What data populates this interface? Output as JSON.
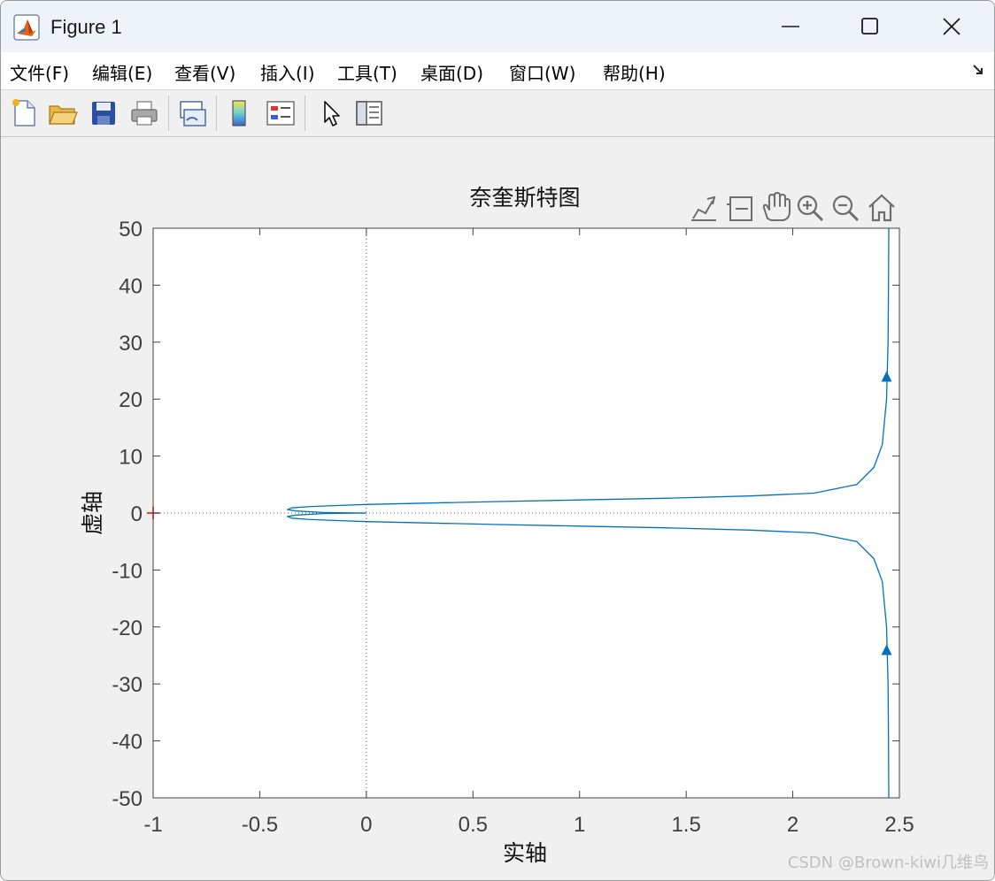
{
  "window": {
    "title": "Figure 1"
  },
  "menu": {
    "items": [
      "文件(F)",
      "编辑(E)",
      "查看(V)",
      "插入(I)",
      "工具(T)",
      "桌面(D)",
      "窗口(W)",
      "帮助(H)"
    ]
  },
  "toolbar": {
    "buttons": [
      "new-figure-icon",
      "open-file-icon",
      "save-icon",
      "print-icon",
      "link-plot-icon",
      "colorbar-icon",
      "legend-icon",
      "edit-plot-cursor-icon",
      "property-inspector-icon"
    ]
  },
  "axes_toolbar": {
    "buttons": [
      "data-tip-icon",
      "brush-icon",
      "pan-hand-icon",
      "zoom-in-icon",
      "zoom-out-icon",
      "home-icon"
    ]
  },
  "colors": {
    "line": "#0072bd",
    "critical_point": "#ff0000",
    "axes": "#404040"
  },
  "chart_data": {
    "type": "line",
    "title": "奈奎斯特图",
    "xlabel": "实轴",
    "ylabel": "虚轴",
    "xlim": [
      -1,
      2.5
    ],
    "ylim": [
      -50,
      50
    ],
    "xticks": [
      "-1",
      "-0.5",
      "0",
      "0.5",
      "1",
      "1.5",
      "2",
      "2.5"
    ],
    "yticks": [
      "-50",
      "-40",
      "-30",
      "-20",
      "-10",
      "0",
      "10",
      "20",
      "30",
      "40",
      "50"
    ],
    "critical_point": [
      -1,
      0
    ],
    "series": [
      {
        "x": [
          2.45,
          2.449,
          2.447,
          2.44,
          2.42,
          2.38,
          2.3,
          2.1,
          1.8,
          1.4,
          1.0,
          0.6,
          0.3,
          0.0,
          -0.15,
          -0.28,
          -0.35,
          -0.37,
          -0.33,
          -0.2,
          0.0
        ],
        "y": [
          50,
          40,
          30,
          20,
          12,
          8,
          5,
          3.5,
          3.0,
          2.6,
          2.3,
          2.0,
          1.75,
          1.5,
          1.3,
          1.1,
          0.9,
          0.6,
          0.35,
          0.1,
          0.0
        ]
      },
      {
        "x": [
          2.45,
          2.449,
          2.447,
          2.44,
          2.42,
          2.38,
          2.3,
          2.1,
          1.8,
          1.4,
          1.0,
          0.6,
          0.3,
          0.0,
          -0.15,
          -0.28,
          -0.35,
          -0.37,
          -0.33,
          -0.2,
          0.0
        ],
        "y": [
          -50,
          -40,
          -30,
          -20,
          -12,
          -8,
          -5,
          -3.5,
          -3.0,
          -2.6,
          -2.3,
          -2.0,
          -1.75,
          -1.5,
          -1.3,
          -1.1,
          -0.9,
          -0.6,
          -0.35,
          -0.1,
          0.0
        ]
      }
    ],
    "arrows": [
      {
        "x": 2.44,
        "y": 24
      },
      {
        "x": 2.44,
        "y": -24
      }
    ]
  },
  "watermark": "CSDN @Brown-kiwi几维鸟"
}
